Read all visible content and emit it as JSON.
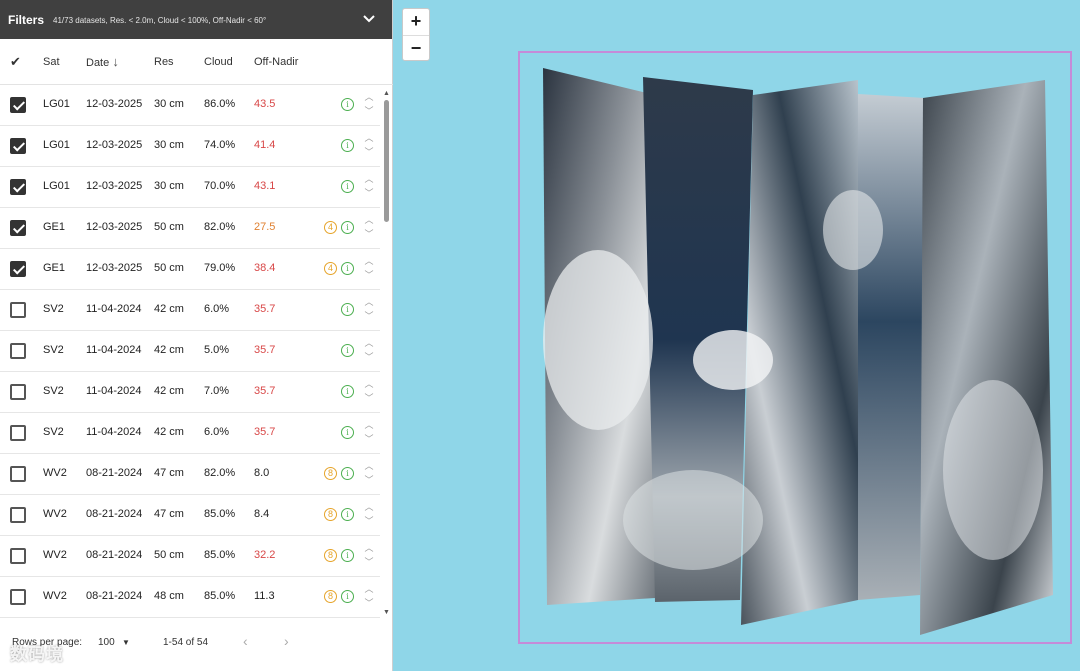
{
  "filters": {
    "title": "Filters",
    "summary": "41/73 datasets, Res. < 2.0m, Cloud < 100%, Off-Nadir < 60°",
    "toggle_icon": "chevron-down-icon"
  },
  "table": {
    "header": {
      "check_glyph": "✔",
      "sat": "Sat",
      "date": "Date",
      "date_sort_icon": "↓",
      "res": "Res",
      "cloud": "Cloud",
      "off_nadir": "Off-Nadir"
    },
    "rows": [
      {
        "checked": true,
        "sat": "LG01",
        "date": "12-03-2025",
        "res": "30 cm",
        "cloud": "86.0%",
        "off": "43.5",
        "off_color": "red",
        "warn": ""
      },
      {
        "checked": true,
        "sat": "LG01",
        "date": "12-03-2025",
        "res": "30 cm",
        "cloud": "74.0%",
        "off": "41.4",
        "off_color": "red",
        "warn": ""
      },
      {
        "checked": true,
        "sat": "LG01",
        "date": "12-03-2025",
        "res": "30 cm",
        "cloud": "70.0%",
        "off": "43.1",
        "off_color": "red",
        "warn": ""
      },
      {
        "checked": true,
        "sat": "GE1",
        "date": "12-03-2025",
        "res": "50 cm",
        "cloud": "82.0%",
        "off": "27.5",
        "off_color": "orange",
        "warn": "4"
      },
      {
        "checked": true,
        "sat": "GE1",
        "date": "12-03-2025",
        "res": "50 cm",
        "cloud": "79.0%",
        "off": "38.4",
        "off_color": "red",
        "warn": "4"
      },
      {
        "checked": false,
        "sat": "SV2",
        "date": "11-04-2024",
        "res": "42 cm",
        "cloud": "6.0%",
        "off": "35.7",
        "off_color": "red",
        "warn": ""
      },
      {
        "checked": false,
        "sat": "SV2",
        "date": "11-04-2024",
        "res": "42 cm",
        "cloud": "5.0%",
        "off": "35.7",
        "off_color": "red",
        "warn": ""
      },
      {
        "checked": false,
        "sat": "SV2",
        "date": "11-04-2024",
        "res": "42 cm",
        "cloud": "7.0%",
        "off": "35.7",
        "off_color": "red",
        "warn": ""
      },
      {
        "checked": false,
        "sat": "SV2",
        "date": "11-04-2024",
        "res": "42 cm",
        "cloud": "6.0%",
        "off": "35.7",
        "off_color": "red",
        "warn": ""
      },
      {
        "checked": false,
        "sat": "WV2",
        "date": "08-21-2024",
        "res": "47 cm",
        "cloud": "82.0%",
        "off": "8.0",
        "off_color": "black",
        "warn": "8"
      },
      {
        "checked": false,
        "sat": "WV2",
        "date": "08-21-2024",
        "res": "47 cm",
        "cloud": "85.0%",
        "off": "8.4",
        "off_color": "black",
        "warn": "8"
      },
      {
        "checked": false,
        "sat": "WV2",
        "date": "08-21-2024",
        "res": "50 cm",
        "cloud": "85.0%",
        "off": "32.2",
        "off_color": "red",
        "warn": "8"
      },
      {
        "checked": false,
        "sat": "WV2",
        "date": "08-21-2024",
        "res": "48 cm",
        "cloud": "85.0%",
        "off": "11.3",
        "off_color": "black",
        "warn": "8"
      }
    ],
    "info_glyph": "i"
  },
  "footer": {
    "rows_per_page_label": "Rows per page:",
    "rows_per_page_value": "100",
    "range": "1-54 of 54",
    "prev_icon": "‹",
    "next_icon": "›"
  },
  "watermark": "数码境",
  "map": {
    "zoom_in": "+",
    "zoom_out": "−",
    "background_color": "#8fd6e8",
    "aoi_color": "#c58bd8"
  }
}
